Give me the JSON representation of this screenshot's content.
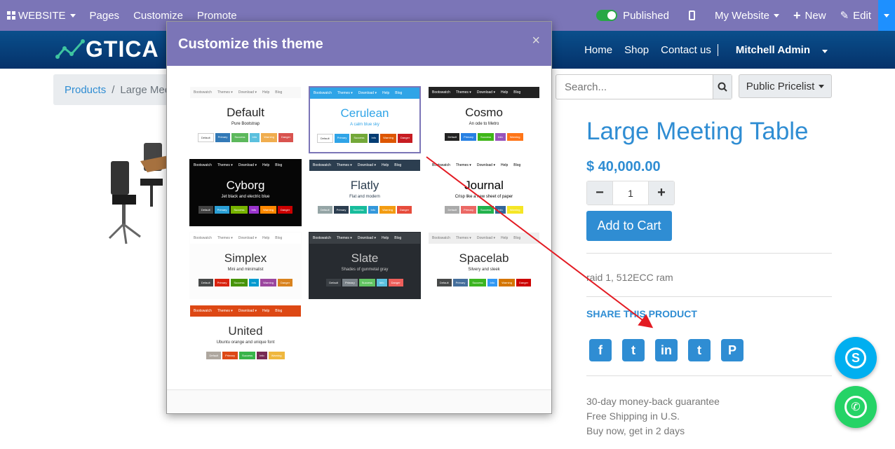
{
  "editbar": {
    "website": "WEBSITE",
    "pages": "Pages",
    "customize": "Customize",
    "promote": "Promote",
    "published": "Published",
    "my_website": "My Website",
    "new": "New",
    "edit": "Edit"
  },
  "header": {
    "logo": "GTICA",
    "nav": [
      "Home",
      "Shop",
      "Contact us"
    ],
    "admin": "Mitchell Admin"
  },
  "breadcrumb": {
    "products": "Products",
    "separator": "/",
    "current": "Large Mee"
  },
  "search": {
    "placeholder": "Search..."
  },
  "pricelist": "Public Pricelist",
  "product": {
    "title": "Large Meeting Table",
    "price": "$ 40,000.00",
    "qty_minus": "−",
    "qty": "1",
    "qty_plus": "+",
    "add_to_cart": "Add to Cart",
    "description": "raid 1, 512ECC ram",
    "share": "SHARE THIS PRODUCT",
    "guarantee": [
      "30-day money-back guarantee",
      "Free Shipping in U.S.",
      "Buy now, get in 2 days"
    ]
  },
  "social_icons": [
    "facebook-icon",
    "twitter-icon",
    "linkedin-icon",
    "tumblr-icon",
    "pinterest-icon"
  ],
  "modal": {
    "title": "Customize this theme",
    "close": "×",
    "themes": [
      {
        "name": "Default",
        "sub": "Pure Bootstrap",
        "bg": "#ffffff",
        "fg": "#222222",
        "nav": "#f8f8f8",
        "navfg": "#777777",
        "buttons": [
          "Default",
          "Primary",
          "Success",
          "Info",
          "Warning",
          "Danger"
        ],
        "colors": [
          "#ffffff",
          "#337ab7",
          "#5cb85c",
          "#5bc0de",
          "#f0ad4e",
          "#d9534f"
        ]
      },
      {
        "name": "Cerulean",
        "sub": "A calm blue sky",
        "bg": "#ffffff",
        "fg": "#2fa4e7",
        "nav": "#2fa4e7",
        "navfg": "#ffffff",
        "buttons": [
          "Default",
          "Primary",
          "Success",
          "Info",
          "Warning",
          "Danger"
        ],
        "colors": [
          "#ffffff",
          "#2fa4e7",
          "#73a839",
          "#033c73",
          "#dd5600",
          "#c71c22"
        ]
      },
      {
        "name": "Cosmo",
        "sub": "An ode to Metro",
        "bg": "#ffffff",
        "fg": "#222222",
        "nav": "#222222",
        "navfg": "#ffffff",
        "buttons": [
          "Default",
          "Primary",
          "Success",
          "Info",
          "Warning"
        ],
        "colors": [
          "#222222",
          "#2780e3",
          "#3fb618",
          "#9954bb",
          "#ff7518"
        ]
      },
      {
        "name": "Cyborg",
        "sub": "Jet black and electric blue",
        "bg": "#060606",
        "fg": "#ffffff",
        "nav": "#060606",
        "navfg": "#ffffff",
        "buttons": [
          "Default",
          "Primary",
          "Success",
          "Info",
          "Warning",
          "Danger"
        ],
        "colors": [
          "#424242",
          "#2a9fd6",
          "#77b300",
          "#9933cc",
          "#ff8800",
          "#cc0000"
        ]
      },
      {
        "name": "Flatly",
        "sub": "Flat and modern",
        "bg": "#ffffff",
        "fg": "#2c3e50",
        "nav": "#2c3e50",
        "navfg": "#ffffff",
        "buttons": [
          "Default",
          "Primary",
          "Success",
          "Info",
          "Warning",
          "Danger"
        ],
        "colors": [
          "#95a5a6",
          "#2c3e50",
          "#18bc9c",
          "#3498db",
          "#f39c12",
          "#e74c3c"
        ]
      },
      {
        "name": "Journal",
        "sub": "Crisp like a new sheet of paper",
        "bg": "#ffffff",
        "fg": "#000000",
        "nav": "#ffffff",
        "navfg": "#000000",
        "buttons": [
          "Default",
          "Primary",
          "Success",
          "Info",
          "Warning"
        ],
        "colors": [
          "#aaaaaa",
          "#eb6864",
          "#22b24c",
          "#336699",
          "#f5e625"
        ]
      },
      {
        "name": "Simplex",
        "sub": "Mini and minimalist",
        "bg": "#fcfcfc",
        "fg": "#333333",
        "nav": "#ffffff",
        "navfg": "#777777",
        "buttons": [
          "Default",
          "Primary",
          "Success",
          "Info",
          "Warning",
          "Danger"
        ],
        "colors": [
          "#474949",
          "#d9230f",
          "#469408",
          "#029acf",
          "#9b479f",
          "#d9831f"
        ]
      },
      {
        "name": "Slate",
        "sub": "Shades of gunmetal gray",
        "bg": "#272b30",
        "fg": "#c8c8c8",
        "nav": "#3a3f44",
        "navfg": "#ffffff",
        "buttons": [
          "Default",
          "Primary",
          "Success",
          "Info",
          "Danger"
        ],
        "colors": [
          "#3a3f44",
          "#7a8288",
          "#62c462",
          "#5bc0de",
          "#ee5f5b"
        ]
      },
      {
        "name": "Spacelab",
        "sub": "Silvery and sleek",
        "bg": "#ffffff",
        "fg": "#2d2d2d",
        "nav": "#eeeeee",
        "navfg": "#777777",
        "buttons": [
          "Default",
          "Primary",
          "Success",
          "Info",
          "Warning",
          "Danger"
        ],
        "colors": [
          "#474949",
          "#446e9b",
          "#3cb521",
          "#3399f3",
          "#d47500",
          "#cd0200"
        ]
      },
      {
        "name": "United",
        "sub": "Ubuntu orange and unique font",
        "bg": "#ffffff",
        "fg": "#333333",
        "nav": "#dd4814",
        "navfg": "#ffffff",
        "buttons": [
          "Default",
          "Primary",
          "Success",
          "Info",
          "Warning"
        ],
        "colors": [
          "#aea79f",
          "#dd4814",
          "#38b44a",
          "#772953",
          "#efb73e"
        ]
      }
    ]
  },
  "colors": {
    "editbar": "#7b75b7",
    "accent": "#2f8dd3",
    "header": "#05326a",
    "skype": "#00aff0",
    "whatsapp": "#25d366"
  }
}
